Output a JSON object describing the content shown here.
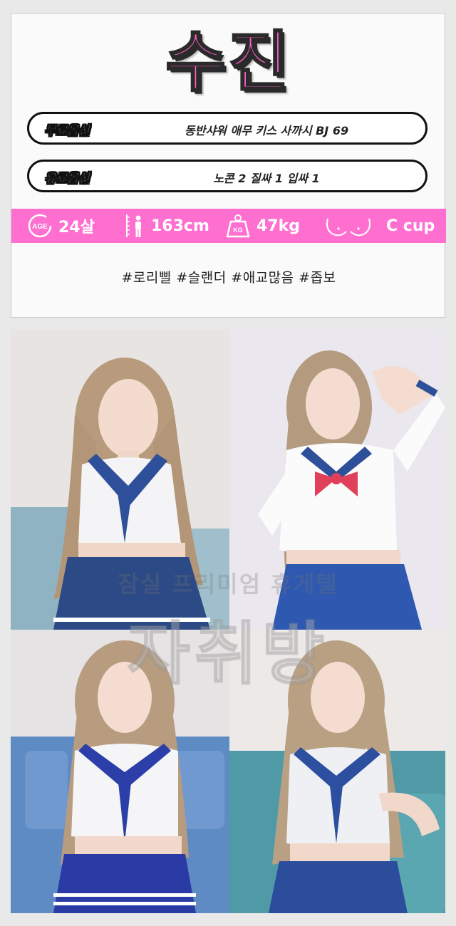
{
  "profile": {
    "name": "수진",
    "free_option": {
      "label": "무료옵션",
      "value": "동반샤워  애무  키스  사까시  BJ  69"
    },
    "paid_option": {
      "label": "유료옵션",
      "value": "노콘 2  질싸 1  입싸 1"
    },
    "specs": {
      "age_icon_text": "AGE",
      "age": "24살",
      "height": "163cm",
      "weight_icon_text": "KG",
      "weight": "47kg",
      "cup": "C cup"
    },
    "tags": "#로리삘 #슬랜더 #애교많음 #좁보"
  },
  "watermark": {
    "line1": "잠실 프리미엄 휴게텔",
    "line2": "자취방"
  },
  "colors": {
    "accent_pink": "#ff6fd0",
    "name_pink": "#ff5ec8"
  }
}
